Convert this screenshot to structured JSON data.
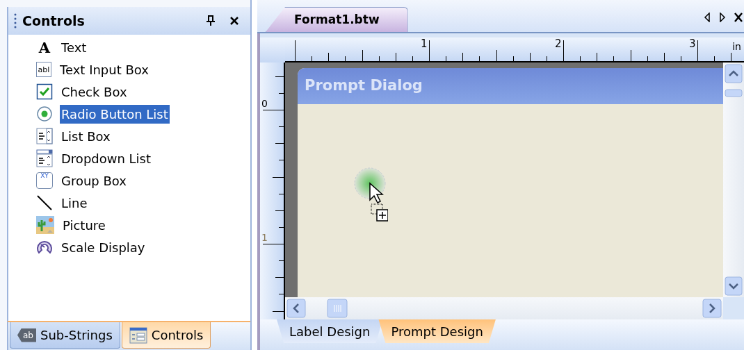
{
  "controls_panel": {
    "title": "Controls",
    "items": [
      {
        "kind": "text",
        "glyph": "A",
        "label": "Text",
        "selected": false
      },
      {
        "kind": "input",
        "glyph": "abl",
        "label": "Text Input Box",
        "selected": false
      },
      {
        "kind": "checkbox",
        "label": "Check Box",
        "selected": false
      },
      {
        "kind": "radio",
        "label": "Radio Button List",
        "selected": true
      },
      {
        "kind": "listbox",
        "label": "List Box",
        "selected": false
      },
      {
        "kind": "dropdown",
        "label": "Dropdown List",
        "selected": false
      },
      {
        "kind": "groupbox",
        "glyph": "XY",
        "label": "Group Box",
        "selected": false
      },
      {
        "kind": "line",
        "label": "Line",
        "selected": false
      },
      {
        "kind": "picture",
        "label": "Picture",
        "selected": false
      },
      {
        "kind": "scale",
        "label": "Scale Display",
        "selected": false
      }
    ],
    "tabs": [
      {
        "kind": "substrings",
        "glyph": "ab",
        "label": "Sub-Strings",
        "selected": false
      },
      {
        "kind": "controls",
        "label": "Controls",
        "selected": true
      }
    ]
  },
  "document": {
    "tab": "Format1.btw",
    "ruler": {
      "horizontal_labels": [
        "1",
        "2",
        "3"
      ],
      "unit": "in",
      "vertical_labels": [
        "0",
        "1"
      ]
    },
    "dialog": {
      "title": "Prompt Dialog"
    },
    "tabs": [
      {
        "label": "Label Design",
        "selected": false
      },
      {
        "label": "Prompt Design",
        "selected": true
      }
    ]
  }
}
